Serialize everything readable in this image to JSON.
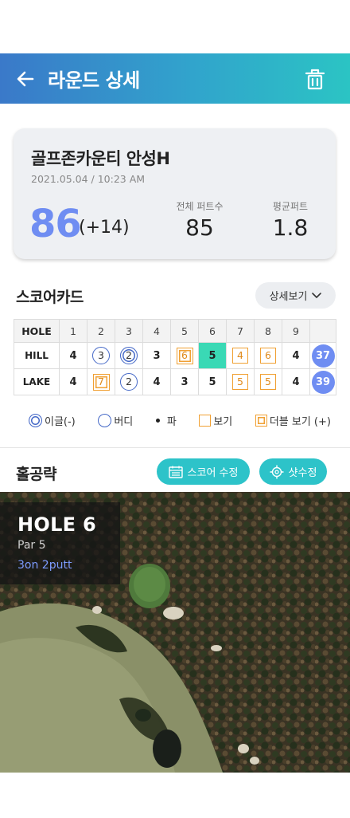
{
  "header": {
    "title": "라운드 상세",
    "back_icon": "arrow-left-icon",
    "delete_icon": "trash-icon"
  },
  "summary": {
    "course": "골프존카운티 안성H",
    "datetime": "2021.05.04 / 10:23 AM",
    "score": "86",
    "over_par": "(+14)",
    "total_putts_label": "전체 퍼트수",
    "total_putts": "85",
    "avg_putts_label": "평균퍼트",
    "avg_putts": "1.8"
  },
  "scorecard": {
    "title": "스코어카드",
    "detail_button": "상세보기",
    "header_label": "HOLE",
    "holes": [
      "1",
      "2",
      "3",
      "4",
      "5",
      "6",
      "7",
      "8",
      "9"
    ],
    "rows": [
      {
        "name": "HILL",
        "scores": [
          "4",
          "3",
          "2",
          "3",
          "6",
          "5",
          "4",
          "6",
          "4"
        ],
        "marks": [
          "par",
          "birdie",
          "eagle",
          "par",
          "dbogey",
          "par",
          "bogey",
          "bogey",
          "par"
        ],
        "total": "37"
      },
      {
        "name": "LAKE",
        "scores": [
          "4",
          "7",
          "2",
          "4",
          "3",
          "5",
          "5",
          "5",
          "4"
        ],
        "marks": [
          "par",
          "dbogey",
          "birdie",
          "par",
          "par",
          "par",
          "bogey",
          "bogey",
          "par"
        ],
        "total": "39"
      }
    ],
    "highlight": {
      "row": 0,
      "hole": 6,
      "color": "#3ad9b5"
    }
  },
  "legend": {
    "eagle": "이글(-)",
    "birdie": "버디",
    "par": "파",
    "bogey": "보기",
    "double_bogey": "더블 보기 (+)"
  },
  "strategy": {
    "title": "홀공략",
    "edit_score_button": "스코어 수정",
    "edit_shots_button": "샷수정"
  },
  "hole": {
    "name": "HOLE 6",
    "par": "Par 5",
    "result": "3on 2putt"
  },
  "colors": {
    "accent": "#6f8df2",
    "teal": "#2dc3c9",
    "eagle_birdie": "#4468c7",
    "bogey": "#f0a033"
  }
}
